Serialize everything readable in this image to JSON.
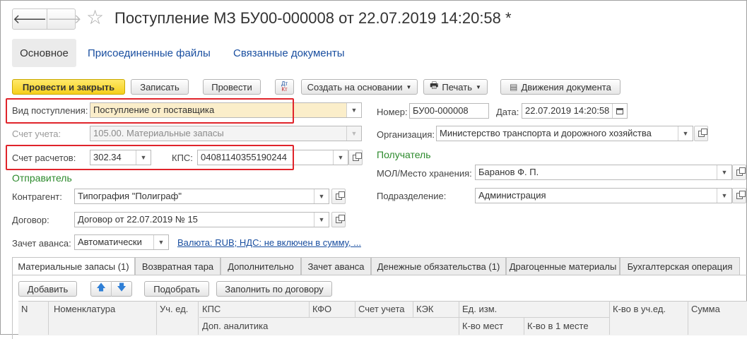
{
  "header": {
    "back_icon": "arrow-left-icon",
    "forward_icon": "arrow-right-icon",
    "favorite_icon": "star-icon",
    "title": "Поступление МЗ БУ00-000008 от 22.07.2019 14:20:58 *"
  },
  "nav_tabs": {
    "main": "Основное",
    "files": "Присоединенные файлы",
    "related": "Связанные документы"
  },
  "toolbar": {
    "post_close": "Провести и закрыть",
    "save": "Записать",
    "post": "Провести",
    "dtkt_top": "Дт",
    "dtkt_bottom": "Кт",
    "create_based": "Создать на основании",
    "print": "Печать",
    "movements": "Движения документа"
  },
  "form": {
    "receipt_type_label": "Вид поступления:",
    "receipt_type_value": "Поступление от поставщика",
    "account_label": "Счет учета:",
    "account_value": "105.00. Материальные запасы",
    "settlement_label": "Счет расчетов:",
    "settlement_value": "302.34",
    "kps_label": "КПС:",
    "kps_value": "04081140355190244",
    "sender_title": "Отправитель",
    "counterparty_label": "Контрагент:",
    "counterparty_value": "Типография \"Полиграф\"",
    "contract_label": "Договор:",
    "contract_value": "Договор от 22.07.2019 № 15",
    "advance_label": "Зачет аванса:",
    "advance_value": "Автоматически",
    "currency_link": "Валюта: RUB; НДС: не включен в сумму, ...",
    "number_label": "Номер:",
    "number_value": "БУ00-000008",
    "date_label": "Дата:",
    "date_value": "22.07.2019 14:20:58",
    "org_label": "Организация:",
    "org_value": "Министерство транспорта и дорожного хозяйства",
    "recipient_title": "Получатель",
    "mol_label": "МОЛ/Место хранения:",
    "mol_value": "Баранов Ф. П.",
    "dept_label": "Подразделение:",
    "dept_value": "Администрация"
  },
  "tabs": [
    "Материальные запасы (1)",
    "Возвратная тара",
    "Дополнительно",
    "Зачет аванса",
    "Денежные обязательства (1)",
    "Драгоценные материалы",
    "Бухгалтерская операция"
  ],
  "table_toolbar": {
    "add": "Добавить",
    "pick": "Подобрать",
    "fill": "Заполнить по договору"
  },
  "table": {
    "columns_row1": [
      "N",
      "Номенклатура",
      "Уч. ед.",
      "КПС",
      "КФО",
      "Счет учета",
      "КЭК",
      "Ед. изм.",
      "К-во в уч.ед.",
      "Сумма"
    ],
    "columns_row2": [
      "Доп. аналитика",
      "К-во мест",
      "К-во в 1 месте"
    ]
  }
}
